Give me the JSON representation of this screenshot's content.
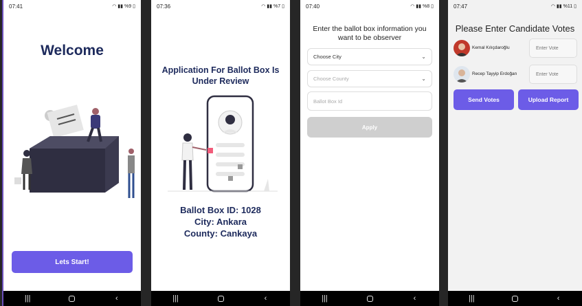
{
  "colors": {
    "accent": "#6c5ce7",
    "navy": "#1d2a5c",
    "disabled": "#cfcfcf"
  },
  "phones": [
    {
      "time": "07:41",
      "battery": "%9",
      "welcome": "Welcome",
      "start_button": "Lets Start!"
    },
    {
      "time": "07:36",
      "battery": "%7",
      "title": "Application For Ballot Box Is Under Review",
      "ballot_box": "Ballot Box ID: 1028",
      "city": "City: Ankara",
      "county": "County: Cankaya"
    },
    {
      "time": "07:40",
      "battery": "%8",
      "heading": "Enter the ballot box information you want to be observer",
      "city_select": "Choose City",
      "county_select": "Choose County",
      "ballot_placeholder": "Ballot Box Id",
      "apply_button": "Apply"
    },
    {
      "time": "07:47",
      "battery": "%11",
      "heading": "Please Enter Candidate Votes",
      "candidates": [
        {
          "name": "Kemal Kılıçdaroğlu",
          "placeholder": "Enter Vote"
        },
        {
          "name": "Recep Tayyip Erdoğan",
          "placeholder": "Enter Vote"
        }
      ],
      "send_button": "Send Votes",
      "upload_button": "Upload Report"
    }
  ],
  "nav_icons": [
    "recent-apps-icon",
    "home-icon",
    "back-icon"
  ]
}
